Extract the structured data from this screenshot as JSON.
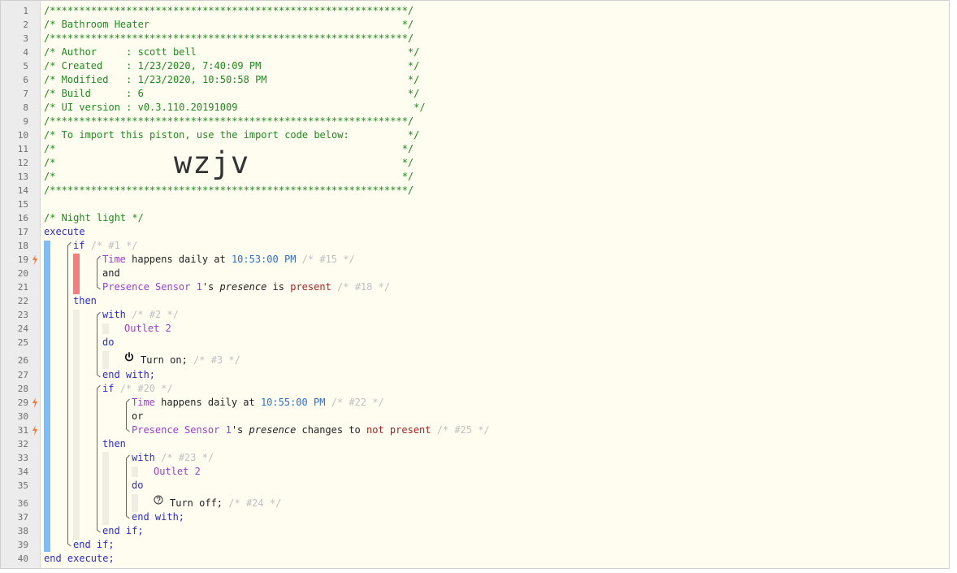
{
  "line_numbers": [
    "1",
    "2",
    "3",
    "4",
    "5",
    "6",
    "7",
    "8",
    "9",
    "10",
    "11",
    "12",
    "13",
    "14",
    "15",
    "16",
    "17",
    "18",
    "19",
    "20",
    "21",
    "22",
    "23",
    "24",
    "25",
    "26",
    "27",
    "28",
    "29",
    "30",
    "31",
    "32",
    "33",
    "34",
    "35",
    "36",
    "37",
    "38",
    "39",
    "40"
  ],
  "header": {
    "stars": "/*************************************************************/",
    "title_line": "/* Bathroom Heater                                           */",
    "author_line": "/* Author     : scott bell                                    */",
    "created_line": "/* Created    : 1/23/2020, 7:40:09 PM                         */",
    "modified_line": "/* Modified   : 1/23/2020, 10:50:58 PM                        */",
    "build_line": "/* Build      : 6                                             */",
    "ui_line": "/* UI version : v0.3.110.20191009                              */",
    "import_line": "/* To import this piston, use the import code below:          */",
    "blank_line": "/*                                                           */",
    "import_code": "wzjv"
  },
  "code": {
    "night_light_comment": "/* Night light */",
    "execute": "execute",
    "end_execute": "end execute;",
    "if_kw": "if",
    "then_kw": "then",
    "end_if": "end if;",
    "with_kw": "with",
    "do_kw": "do",
    "end_with": "end with;",
    "and_kw": "and",
    "or_kw": "or",
    "time": "Time",
    "happens_daily_at": " happens daily at ",
    "time1": "10:53:00 PM",
    "time2": "10:55:00 PM",
    "sensor": "Presence Sensor 1",
    "possessive": "'s ",
    "presence": "presence",
    "is": " is ",
    "present": "present",
    "changes_to": " changes to ",
    "not_present": "not present",
    "outlet": "Outlet 2",
    "turn_on": "Turn on;",
    "turn_off": "Turn off;",
    "ref1": "/* #1 */",
    "ref15": "/* #15 */",
    "ref18": "/* #18 */",
    "ref2": "/* #2 */",
    "ref3": "/* #3 */",
    "ref20": "/* #20 */",
    "ref22": "/* #22 */",
    "ref25": "/* #25 */",
    "ref23": "/* #23 */",
    "ref24": "/* #24 */"
  },
  "colors": {
    "comment": "#1f8a1f",
    "keyword": "#2a2ad6",
    "device": "#9b3dd8",
    "bar_blue": "#7fbdf5",
    "bar_red": "#f08080",
    "trigger_bolt": "#f07a3a"
  },
  "icons": {
    "trigger": "lightning-bolt-icon",
    "turn_on": "power-icon",
    "turn_off": "question-mark-circle-icon"
  }
}
